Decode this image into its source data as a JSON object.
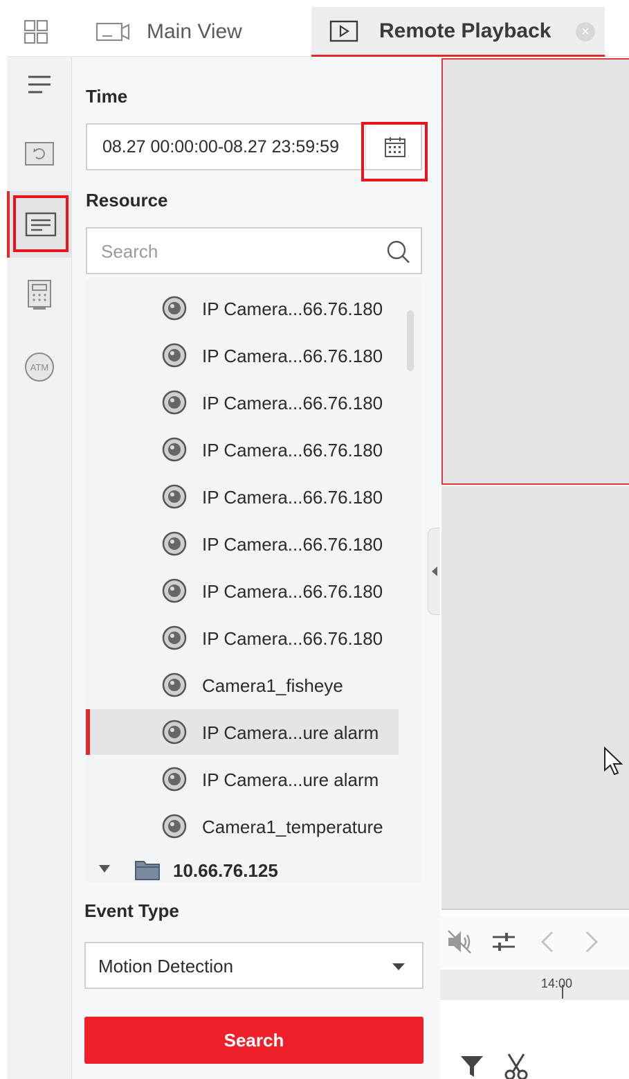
{
  "tabs": {
    "main_view_label": "Main View",
    "remote_playback_label": "Remote Playback",
    "close_glyph": "×"
  },
  "rail": {
    "items": [
      "menu-icon",
      "playback-icon",
      "event-list-icon",
      "calculator-icon",
      "atm-icon"
    ],
    "active_index": 2,
    "atm_text": "ATM"
  },
  "panel": {
    "time_title": "Time",
    "time_range": "08.27 00:00:00-08.27 23:59:59",
    "resource_title": "Resource",
    "search_placeholder": "Search",
    "cameras": [
      {
        "label": "IP Camera...66.76.180",
        "selected": false
      },
      {
        "label": "IP Camera...66.76.180",
        "selected": false
      },
      {
        "label": "IP Camera...66.76.180",
        "selected": false
      },
      {
        "label": "IP Camera...66.76.180",
        "selected": false
      },
      {
        "label": "IP Camera...66.76.180",
        "selected": false
      },
      {
        "label": "IP Camera...66.76.180",
        "selected": false
      },
      {
        "label": "IP Camera...66.76.180",
        "selected": false
      },
      {
        "label": "IP Camera...66.76.180",
        "selected": false
      },
      {
        "label": "Camera1_fisheye",
        "selected": false
      },
      {
        "label": "IP Camera...ure alarm",
        "selected": true
      },
      {
        "label": "IP Camera...ure alarm",
        "selected": false
      },
      {
        "label": "Camera1_temperature",
        "selected": false
      }
    ],
    "folder_label": "10.66.76.125",
    "event_type_title": "Event Type",
    "event_type_value": "Motion Detection",
    "search_button_label": "Search"
  },
  "playback": {
    "timeline_tick": "14:00"
  },
  "colors": {
    "accent": "#f0202a",
    "highlight": "#e8141c"
  }
}
